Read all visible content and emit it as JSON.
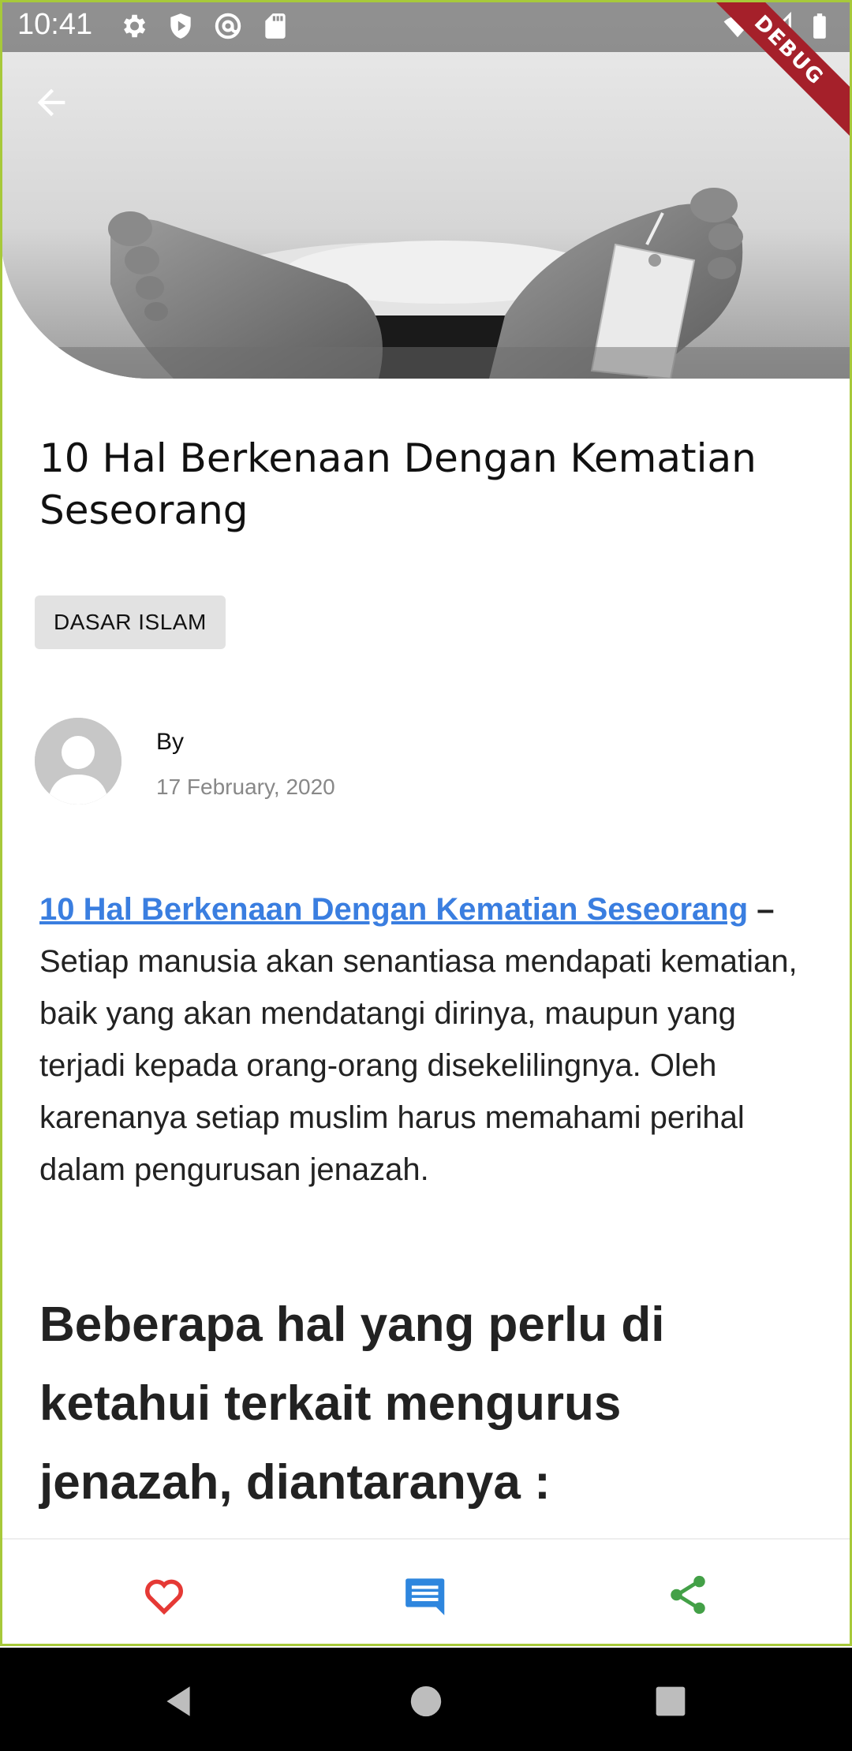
{
  "status_bar": {
    "time": "10:41",
    "left_icons": [
      "settings-icon",
      "shield-icon",
      "at-sign-icon",
      "sd-card-icon"
    ],
    "right_icons": [
      "wifi-icon",
      "cellular-signal-icon",
      "battery-icon"
    ]
  },
  "debug_banner": {
    "label": "DEBUG",
    "color": "#a5202a"
  },
  "header": {
    "back_icon": "arrow-back-icon",
    "hero_image": "toe-tag-feet-photo"
  },
  "article": {
    "title": "10 Hal Berkenaan Dengan Kematian Seseorang",
    "category": "DASAR ISLAM",
    "author": {
      "avatar_icon": "default-user-avatar",
      "by_label": "By",
      "date": "17 February, 2020"
    },
    "body": {
      "link_text": "10 Hal Berkenaan Dengan Kematian Seseorang",
      "dash": " –",
      "text": " Setiap manusia akan senantiasa mendapati kematian, baik yang akan mendatangi dirinya, maupun yang terjadi kepada orang-orang disekelilingnya. Oleh karenanya setiap muslim harus memahami perihal dalam pengurusan jenazah."
    },
    "section_heading": "Beberapa hal yang perlu di ketahui terkait mengurus jenazah, diantaranya :"
  },
  "action_bar": {
    "like_icon": "heart-icon",
    "comment_icon": "comment-icon",
    "share_icon": "share-icon",
    "colors": {
      "like": "#e53935",
      "comment": "#2e86de",
      "share": "#43a047"
    }
  },
  "nav_bar": {
    "back_icon": "nav-back-icon",
    "home_icon": "nav-home-icon",
    "recents_icon": "nav-recents-icon"
  },
  "colors": {
    "link": "#3a7ee0",
    "chip_bg": "#e2e2e2",
    "frame_border": "#a7c93a"
  }
}
